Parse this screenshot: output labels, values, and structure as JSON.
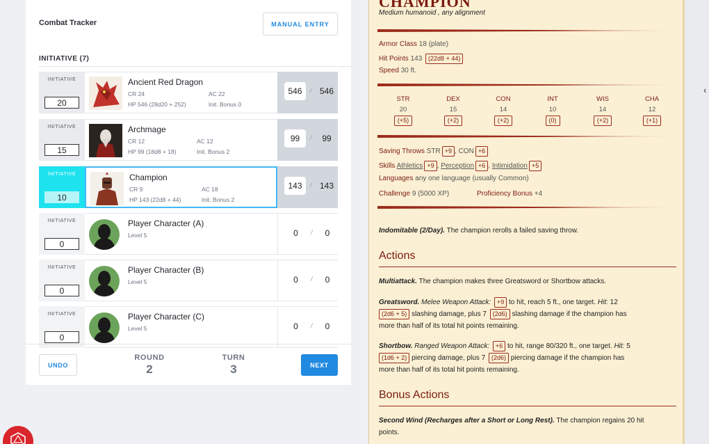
{
  "tracker": {
    "title": "Combat Tracker",
    "manual_entry": "MANUAL ENTRY",
    "initiative_heading": "INITIATIVE (7)",
    "init_label": "INITIATIVE"
  },
  "combatants": [
    {
      "name": "Ancient Red Dragon",
      "cr": "CR 24",
      "ac": "AC 22",
      "hp_line": "HP 546 (28d20 + 252)",
      "bonus": "Init. Bonus 0",
      "initiative": "20",
      "hp_current": "546",
      "hp_max": "546",
      "hp_sep": "/"
    },
    {
      "name": "Archmage",
      "cr": "CR 12",
      "ac": "AC 12",
      "hp_line": "HP 99 (18d8 + 18)",
      "bonus": "Init. Bonus 2",
      "initiative": "15",
      "hp_current": "99",
      "hp_max": "99",
      "hp_sep": "/"
    },
    {
      "name": "Champion",
      "cr": "CR 9",
      "ac": "AC 18",
      "hp_line": "HP 143 (22d8 + 44)",
      "bonus": "Init. Bonus 2",
      "initiative": "10",
      "hp_current": "143",
      "hp_max": "143",
      "hp_sep": "/"
    },
    {
      "name": "Player Character (A)",
      "level": "Level 5",
      "initiative": "0",
      "hp_current": "0",
      "hp_max": "0",
      "hp_sep": "/"
    },
    {
      "name": "Player Character (B)",
      "level": "Level 5",
      "initiative": "0",
      "hp_current": "0",
      "hp_max": "0",
      "hp_sep": "/"
    },
    {
      "name": "Player Character (C)",
      "level": "Level 5",
      "initiative": "0",
      "hp_current": "0",
      "hp_max": "0",
      "hp_sep": "/"
    }
  ],
  "footer": {
    "undo": "UNDO",
    "round_label": "ROUND",
    "round_value": "2",
    "turn_label": "TURN",
    "turn_value": "3",
    "next": "NEXT"
  },
  "statblock": {
    "name": "CHAMPION",
    "type": "Medium humanoid , any alignment",
    "armor_class_label": "Armor Class",
    "armor_class_value": "18 (plate)",
    "hit_points_label": "Hit Points",
    "hit_points_value": "143",
    "hit_points_dice": "(22d8 + 44)",
    "speed_label": "Speed",
    "speed_value": "30 ft.",
    "abilities": [
      {
        "name": "STR",
        "score": "20",
        "mod": "(+5)"
      },
      {
        "name": "DEX",
        "score": "15",
        "mod": "(+2)"
      },
      {
        "name": "CON",
        "score": "14",
        "mod": "(+2)"
      },
      {
        "name": "INT",
        "score": "10",
        "mod": "(0)"
      },
      {
        "name": "WIS",
        "score": "14",
        "mod": "(+2)"
      },
      {
        "name": "CHA",
        "score": "12",
        "mod": "(+1)"
      }
    ],
    "saving_throws_label": "Saving Throws",
    "saving_throws": [
      {
        "name": "STR",
        "mod": "+9"
      },
      {
        "name": "CON",
        "mod": "+6"
      }
    ],
    "skills_label": "Skills",
    "skills": [
      {
        "name": "Athletics",
        "mod": "+9"
      },
      {
        "name": "Perception",
        "mod": "+6"
      },
      {
        "name": "Intimidation",
        "mod": "+5"
      }
    ],
    "languages_label": "Languages",
    "languages_value": "any one language (usually Common)",
    "challenge_label": "Challenge",
    "challenge_value": "9 (5000 XP)",
    "proficiency_label": "Proficiency Bonus",
    "proficiency_value": "+4",
    "trait_name": "Indomitable (2/Day).",
    "trait_text": "The champion rerolls a failed saving throw.",
    "actions_heading": "Actions",
    "multiattack_name": "Multiattack.",
    "multiattack_text": "The champion makes three Greatsword or Shortbow attacks.",
    "greatsword": {
      "name": "Greatsword.",
      "type": "Melee Weapon Attack:",
      "to_hit": "+9",
      "reach": "to hit, reach 5 ft., one target.",
      "hit_label": "Hit:",
      "dmg1": "12",
      "dmg1_dice": "(2d6 + 5)",
      "dmg1_text": "slashing damage, plus 7",
      "dmg2_dice": "(2d6)",
      "dmg2_text": "slashing damage if the champion has",
      "tail": "more than half of its total hit points remaining."
    },
    "shortbow": {
      "name": "Shortbow.",
      "type": "Ranged Weapon Attack:",
      "to_hit": "+6",
      "range": "to hit, range 80/320 ft., one target.",
      "hit_label": "Hit:",
      "dmg1": "5",
      "dmg1_dice": "(1d6 + 2)",
      "dmg1_text": "piercing damage, plus 7",
      "dmg2_dice": "(2d6)",
      "dmg2_text": "piercing damage if the champion has",
      "tail": "more than half of its total hit points remaining."
    },
    "bonus_heading": "Bonus Actions",
    "second_wind_name": "Second Wind (Recharges after a Short or Long Rest).",
    "second_wind_text": "The champion regains 20 hit",
    "second_wind_tail": "points."
  },
  "colors": {
    "accent": "#1f8ae0",
    "active_init": "#1ee2ee",
    "parchment": "#fbf0d4",
    "statblock_red": "#7a1a0f"
  }
}
